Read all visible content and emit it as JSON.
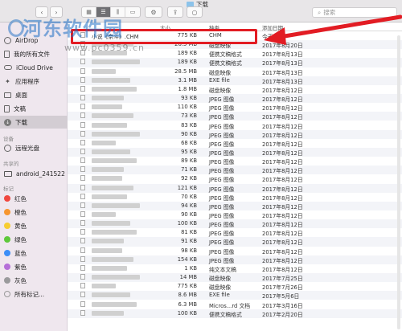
{
  "window": {
    "title": "下载"
  },
  "toolbar": {
    "search_placeholder": "搜索"
  },
  "sidebar": {
    "items": [
      {
        "label": "AirDrop",
        "icon": "airdrop-icon"
      },
      {
        "label": "我的所有文件",
        "icon": "all-files-icon"
      },
      {
        "label": "iCloud Drive",
        "icon": "cloud-icon"
      },
      {
        "label": "应用程序",
        "icon": "applications-icon"
      },
      {
        "label": "桌面",
        "icon": "desktop-icon"
      },
      {
        "label": "文稿",
        "icon": "documents-icon"
      },
      {
        "label": "下载",
        "icon": "downloads-icon"
      }
    ],
    "devices_heading": "设备",
    "devices": [
      {
        "label": "远程光盘",
        "icon": "disc-icon"
      }
    ],
    "shared_heading": "共享的",
    "shared": [
      {
        "label": "android_241522",
        "icon": "computer-icon"
      }
    ],
    "tags_heading": "标记",
    "tags": [
      {
        "label": "红色",
        "color": "#f0473f"
      },
      {
        "label": "橙色",
        "color": "#f7962f"
      },
      {
        "label": "黄色",
        "color": "#f7cd31"
      },
      {
        "label": "绿色",
        "color": "#5ec83a"
      },
      {
        "label": "蓝色",
        "color": "#3c8ef7"
      },
      {
        "label": "紫色",
        "color": "#b56fd8"
      },
      {
        "label": "灰色",
        "color": "#9a9a9c"
      },
      {
        "label": "所有标记...",
        "color": ""
      }
    ]
  },
  "columns": {
    "size": "大小",
    "kind": "种类",
    "date": "添加日期"
  },
  "files": [
    {
      "name": "小说《奈斗》.CHM",
      "size": "775 KB",
      "kind": "CHM",
      "date": "今天"
    },
    {
      "name": "",
      "size": "26.5 MB",
      "kind": "磁盘映像",
      "date": "2017年8月20日"
    },
    {
      "name": "",
      "size": "189 KB",
      "kind": "便携文稿格式",
      "date": "2017年8月13日"
    },
    {
      "name": "",
      "size": "189 KB",
      "kind": "便携文稿格式",
      "date": "2017年8月13日"
    },
    {
      "name": "",
      "size": "28.5 MB",
      "kind": "磁盘映像",
      "date": "2017年8月13日"
    },
    {
      "name": "",
      "size": "3.1 MB",
      "kind": "EXE file",
      "date": "2017年8月13日"
    },
    {
      "name": "",
      "size": "1.8 MB",
      "kind": "磁盘映像",
      "date": "2017年8月12日"
    },
    {
      "name": "",
      "size": "93 KB",
      "kind": "JPEG 图像",
      "date": "2017年8月12日"
    },
    {
      "name": "",
      "size": "110 KB",
      "kind": "JPEG 图像",
      "date": "2017年8月12日"
    },
    {
      "name": "",
      "size": "73 KB",
      "kind": "JPEG 图像",
      "date": "2017年8月12日"
    },
    {
      "name": "",
      "size": "83 KB",
      "kind": "JPEG 图像",
      "date": "2017年8月12日"
    },
    {
      "name": "",
      "size": "90 KB",
      "kind": "JPEG 图像",
      "date": "2017年8月12日"
    },
    {
      "name": "",
      "size": "68 KB",
      "kind": "JPEG 图像",
      "date": "2017年8月12日"
    },
    {
      "name": "",
      "size": "95 KB",
      "kind": "JPEG 图像",
      "date": "2017年8月12日"
    },
    {
      "name": "",
      "size": "89 KB",
      "kind": "JPEG 图像",
      "date": "2017年8月12日"
    },
    {
      "name": "",
      "size": "71 KB",
      "kind": "JPEG 图像",
      "date": "2017年8月12日"
    },
    {
      "name": "",
      "size": "92 KB",
      "kind": "JPEG 图像",
      "date": "2017年8月12日"
    },
    {
      "name": "",
      "size": "121 KB",
      "kind": "JPEG 图像",
      "date": "2017年8月12日"
    },
    {
      "name": "",
      "size": "70 KB",
      "kind": "JPEG 图像",
      "date": "2017年8月12日"
    },
    {
      "name": "",
      "size": "94 KB",
      "kind": "JPEG 图像",
      "date": "2017年8月12日"
    },
    {
      "name": "",
      "size": "90 KB",
      "kind": "JPEG 图像",
      "date": "2017年8月12日"
    },
    {
      "name": "",
      "size": "100 KB",
      "kind": "JPEG 图像",
      "date": "2017年8月12日"
    },
    {
      "name": "",
      "size": "81 KB",
      "kind": "JPEG 图像",
      "date": "2017年8月12日"
    },
    {
      "name": "",
      "size": "91 KB",
      "kind": "JPEG 图像",
      "date": "2017年8月12日"
    },
    {
      "name": "",
      "size": "98 KB",
      "kind": "JPEG 图像",
      "date": "2017年8月12日"
    },
    {
      "name": "",
      "size": "154 KB",
      "kind": "JPEG 图像",
      "date": "2017年8月12日"
    },
    {
      "name": "",
      "size": "1 KB",
      "kind": "纯文本文稿",
      "date": "2017年8月12日"
    },
    {
      "name": "",
      "size": "14 MB",
      "kind": "磁盘映像",
      "date": "2017年7月25日"
    },
    {
      "name": "",
      "size": "775 KB",
      "kind": "磁盘映像",
      "date": "2017年7月26日"
    },
    {
      "name": "",
      "size": "8.6 MB",
      "kind": "EXE file",
      "date": "2017年5月6日"
    },
    {
      "name": "",
      "size": "6.3 MB",
      "kind": "Micros...rd 文档",
      "date": "2017年3月16日"
    },
    {
      "name": "",
      "size": "100 KB",
      "kind": "便携文稿格式",
      "date": "2017年2月20日"
    }
  ],
  "annotation": {
    "highlight_color": "#e21c23"
  }
}
